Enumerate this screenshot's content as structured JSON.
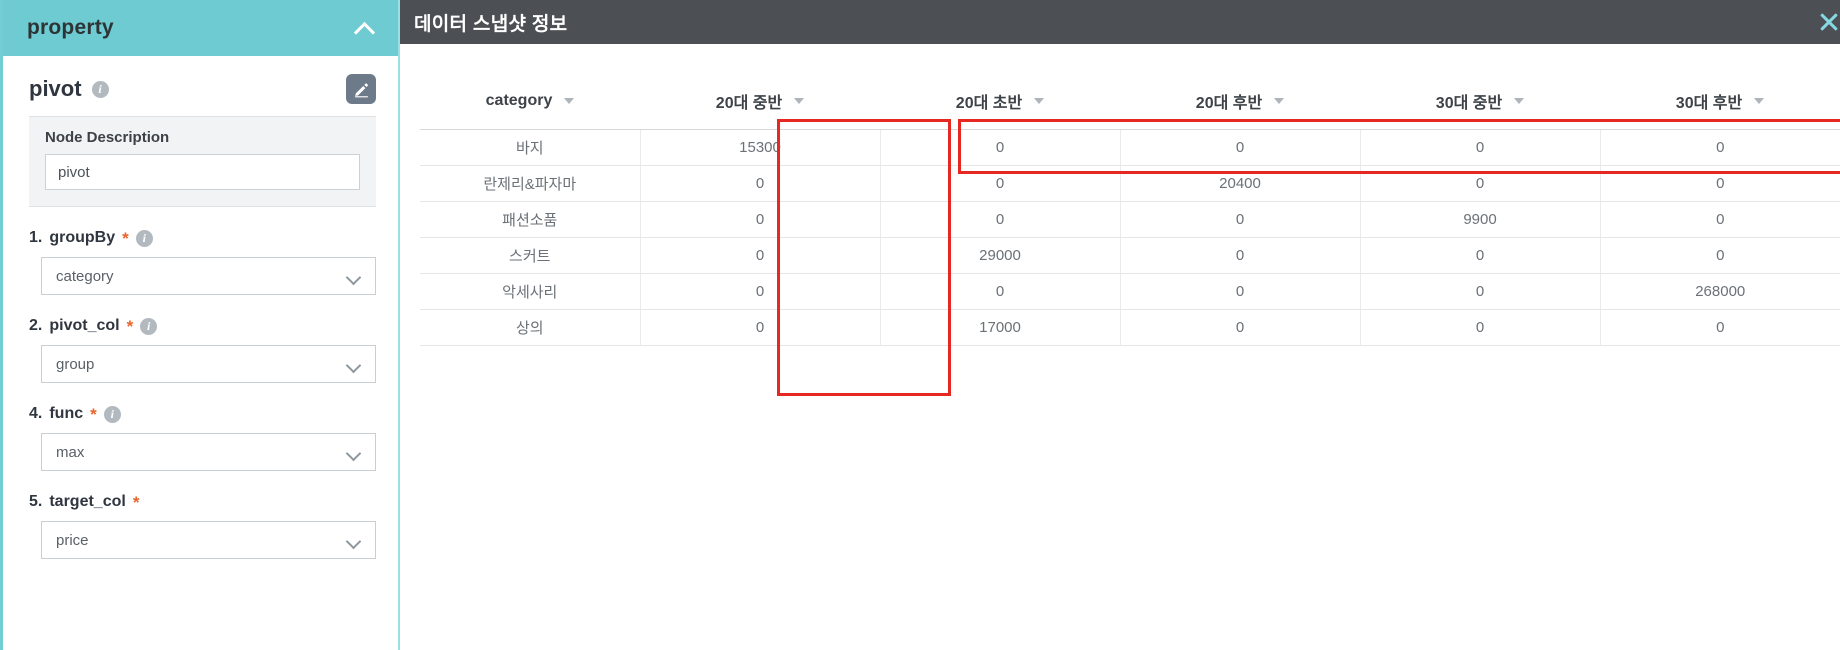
{
  "sidebar": {
    "header": {
      "title": "property",
      "collapse_icon": "chevron-up-icon"
    },
    "node": {
      "name": "pivot",
      "info_icon": "info-icon",
      "edit_icon": "pencil-edit-icon"
    },
    "description": {
      "label": "Node Description",
      "value": "pivot"
    },
    "fields": [
      {
        "index": "1.",
        "name": "groupBy",
        "required": "*",
        "has_info": true,
        "value": "category",
        "caret_icon": "chevron-down-icon"
      },
      {
        "index": "2.",
        "name": "pivot_col",
        "required": "*",
        "has_info": true,
        "value": "group",
        "caret_icon": "chevron-down-icon"
      },
      {
        "index": "4.",
        "name": "func",
        "required": "*",
        "has_info": true,
        "value": "max",
        "caret_icon": "chevron-down-icon"
      },
      {
        "index": "5.",
        "name": "target_col",
        "required": "*",
        "has_info": false,
        "value": "price",
        "caret_icon": "chevron-down-icon"
      }
    ]
  },
  "main": {
    "title": "데이터 스냅샷 정보",
    "close_icon": "close-x-icon",
    "table": {
      "columns": [
        "category",
        "20대 중반",
        "20대 초반",
        "20대 후반",
        "30대 중반",
        "30대 후반"
      ],
      "sort_icon": "sort-caret-icon",
      "rows": [
        {
          "category": "바지",
          "values": [
            "15300",
            "0",
            "0",
            "0",
            "0"
          ]
        },
        {
          "category": "란제리&파자마",
          "values": [
            "0",
            "0",
            "20400",
            "0",
            "0"
          ]
        },
        {
          "category": "패션소품",
          "values": [
            "0",
            "0",
            "0",
            "9900",
            "0"
          ]
        },
        {
          "category": "스커트",
          "values": [
            "0",
            "29000",
            "0",
            "0",
            "0"
          ]
        },
        {
          "category": "악세사리",
          "values": [
            "0",
            "0",
            "0",
            "0",
            "268000"
          ]
        },
        {
          "category": "상의",
          "values": [
            "0",
            "17000",
            "0",
            "0",
            "0"
          ]
        }
      ]
    },
    "highlights": [
      {
        "name": "category-column-highlight",
        "color": "#e52822"
      },
      {
        "name": "pivot-columns-header-highlight",
        "color": "#e52822"
      }
    ]
  },
  "colors": {
    "panel_header_teal": "#6ecbd2",
    "main_header_gray": "#4c5055",
    "close_x_cyan": "#86d9e3",
    "required_star_orange": "#e8632a",
    "highlight_red": "#e52822"
  }
}
